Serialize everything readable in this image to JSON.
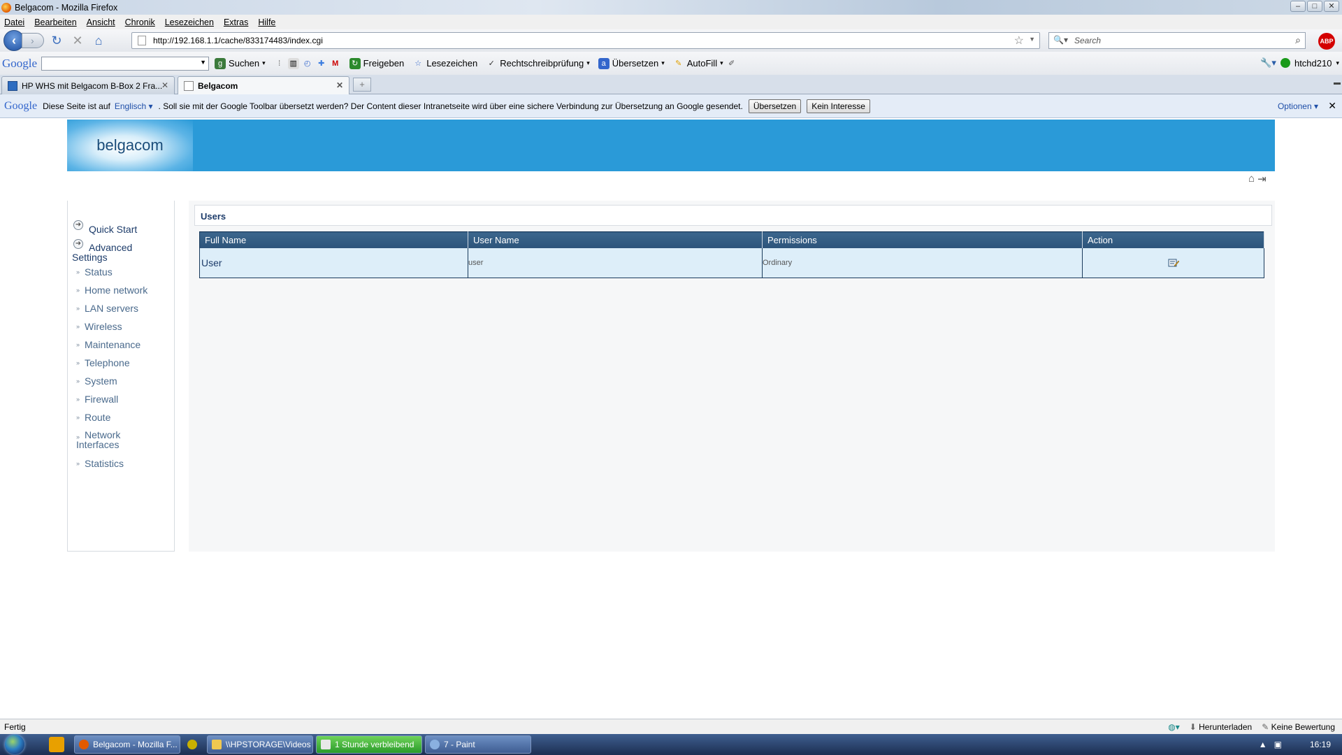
{
  "window": {
    "title": "Belgacom - Mozilla Firefox"
  },
  "menu": [
    "Datei",
    "Bearbeiten",
    "Ansicht",
    "Chronik",
    "Lesezeichen",
    "Extras",
    "Hilfe"
  ],
  "navbar": {
    "url": "http://192.168.1.1/cache/833174483/index.cgi",
    "search_placeholder": "Search",
    "abp": "ABP"
  },
  "google_toolbar": {
    "logo": "Google",
    "buttons": [
      "Suchen",
      "Freigeben",
      "Lesezeichen",
      "Rechtschreibprüfung",
      "Übersetzen",
      "AutoFill"
    ],
    "user": "htchd210"
  },
  "tabs": [
    {
      "label": "HP WHS mit Belgacom B-Box 2 Fra..."
    },
    {
      "label": "Belgacom"
    }
  ],
  "translate_bar": {
    "logo": "Google",
    "prefix": "Diese Seite ist auf",
    "language": "Englisch",
    "message": ". Soll sie mit der Google Toolbar übersetzt werden? Der Content dieser Intranetseite wird über eine sichere Verbindung zur Übersetzung an Google gesendet.",
    "translate_btn": "Übersetzen",
    "no_btn": "Kein Interesse",
    "options": "Optionen"
  },
  "page": {
    "logo": "belgacom",
    "sidebar": {
      "quick_start": "Quick Start",
      "advanced": "Advanced Settings",
      "items": [
        "Status",
        "Home network",
        "LAN servers",
        "Wireless",
        "Maintenance",
        "Telephone",
        "System",
        "Firewall",
        "Route",
        "Network Interfaces",
        "Statistics"
      ]
    },
    "section_title": "Users",
    "table": {
      "headers": [
        "Full Name",
        "User Name",
        "Permissions",
        "Action"
      ],
      "rows": [
        {
          "full_name": "User",
          "user_name": "user",
          "permissions": "Ordinary"
        }
      ]
    }
  },
  "statusbar": {
    "left": "Fertig",
    "download": "Herunterladen",
    "rating": "Keine Bewertung"
  },
  "taskbar": {
    "items": [
      "Belgacom - Mozilla F...",
      "\\\\HPSTORAGE\\Videos",
      "1 Stunde verbleibend",
      "7 - Paint"
    ],
    "clock": "16:19"
  }
}
